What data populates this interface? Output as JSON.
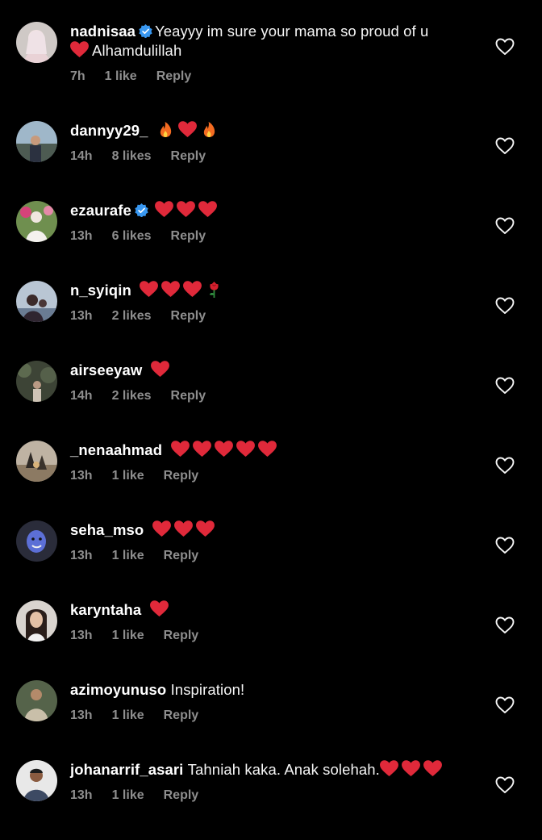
{
  "colors": {
    "background": "#000000",
    "text": "#f5f5f5",
    "meta": "#8e8e8e",
    "heart_emoji": "#e0293a",
    "verified": "#3897f0"
  },
  "comments": [
    {
      "username": "nadnisaa",
      "verified": true,
      "text": "Yeayyy im sure your mama so proud of u",
      "emojis": [
        "red-heart-emoji"
      ],
      "text_after": "Alhamdulillah",
      "time": "7h",
      "likes": "1 like",
      "reply": "Reply"
    },
    {
      "username": "dannyy29_",
      "verified": false,
      "text": "",
      "emojis": [
        "fire-emoji",
        "red-heart-emoji",
        "fire-emoji"
      ],
      "text_after": "",
      "time": "14h",
      "likes": "8 likes",
      "reply": "Reply"
    },
    {
      "username": "ezaurafe",
      "verified": true,
      "text": "",
      "emojis": [
        "red-heart-emoji",
        "red-heart-emoji",
        "red-heart-emoji"
      ],
      "text_after": "",
      "time": "13h",
      "likes": "6 likes",
      "reply": "Reply"
    },
    {
      "username": "n_syiqin",
      "verified": false,
      "text": "",
      "emojis": [
        "red-heart-emoji",
        "red-heart-emoji",
        "red-heart-emoji",
        "rose-emoji"
      ],
      "text_after": "",
      "time": "13h",
      "likes": "2 likes",
      "reply": "Reply"
    },
    {
      "username": "airseeyaw",
      "verified": false,
      "text": "",
      "emojis": [
        "red-heart-emoji"
      ],
      "text_after": "",
      "time": "14h",
      "likes": "2 likes",
      "reply": "Reply"
    },
    {
      "username": "_nenaahmad",
      "verified": false,
      "text": "",
      "emojis": [
        "red-heart-emoji",
        "red-heart-emoji",
        "red-heart-emoji",
        "red-heart-emoji",
        "red-heart-emoji"
      ],
      "text_after": "",
      "time": "13h",
      "likes": "1 like",
      "reply": "Reply"
    },
    {
      "username": "seha_mso",
      "verified": false,
      "text": "",
      "emojis": [
        "red-heart-emoji",
        "red-heart-emoji",
        "red-heart-emoji"
      ],
      "text_after": "",
      "time": "13h",
      "likes": "1 like",
      "reply": "Reply"
    },
    {
      "username": "karyntaha",
      "verified": false,
      "text": "",
      "emojis": [
        "red-heart-emoji"
      ],
      "text_after": "",
      "time": "13h",
      "likes": "1 like",
      "reply": "Reply"
    },
    {
      "username": "azimoyunuso",
      "verified": false,
      "text": "Inspiration!",
      "emojis": [],
      "text_after": "",
      "time": "13h",
      "likes": "1 like",
      "reply": "Reply"
    },
    {
      "username": "johanarrif_asari",
      "verified": false,
      "text": "Tahniah kaka. Anak solehah.",
      "emojis": [
        "red-heart-emoji",
        "red-heart-emoji",
        "red-heart-emoji"
      ],
      "text_after": "",
      "time": "13h",
      "likes": "1 like",
      "reply": "Reply"
    }
  ]
}
